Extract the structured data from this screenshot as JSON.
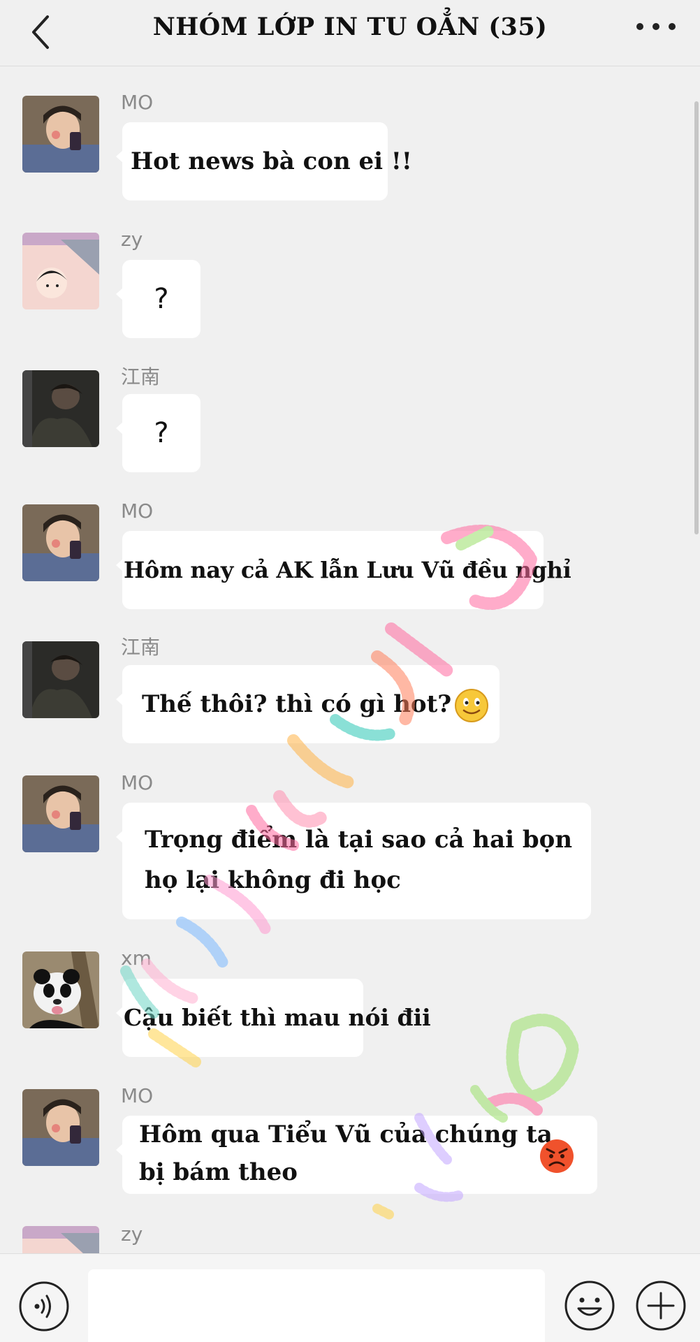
{
  "header": {
    "title": "NHÓM LỚP IN TU OẲN (35)",
    "back_icon": "chevron-left-icon",
    "more_icon": "more-horizontal-icon"
  },
  "messages": [
    {
      "sender": "MO",
      "text": "Hot news bà con ei !!",
      "avatar": "boy-with-phone"
    },
    {
      "sender": "zy",
      "text": "?",
      "avatar": "cartoon-girl"
    },
    {
      "sender": "江南",
      "text": "?",
      "avatar": "dark-photo"
    },
    {
      "sender": "MO",
      "text": "Hôm nay cả AK lẫn Lưu Vũ đều nghỉ",
      "avatar": "boy-with-phone"
    },
    {
      "sender": "江南",
      "text": "Thế thôi? thì có gì hot?",
      "emoji": "smiling-face",
      "avatar": "dark-photo"
    },
    {
      "sender": "MO",
      "lines": [
        "Trọng điểm là tại sao cả hai bọn",
        "họ lại không đi học"
      ],
      "avatar": "boy-with-phone"
    },
    {
      "sender": "xm",
      "text": "Cậu biết thì mau nói đii",
      "avatar": "panda"
    },
    {
      "sender": "MO",
      "lines": [
        "Hôm qua Tiểu Vũ của chúng ta",
        "bị bám theo"
      ],
      "emoji": "angry-face",
      "avatar": "boy-with-phone"
    },
    {
      "sender": "zy",
      "avatar": "cartoon-girl"
    }
  ],
  "input_bar": {
    "voice_icon": "voice-icon",
    "emoji_icon": "emoji-icon",
    "plus_icon": "plus-circle-icon"
  },
  "colors": {
    "background": "#f0f0f0",
    "bubble": "#ffffff",
    "sender_text": "#8a8a8a"
  }
}
